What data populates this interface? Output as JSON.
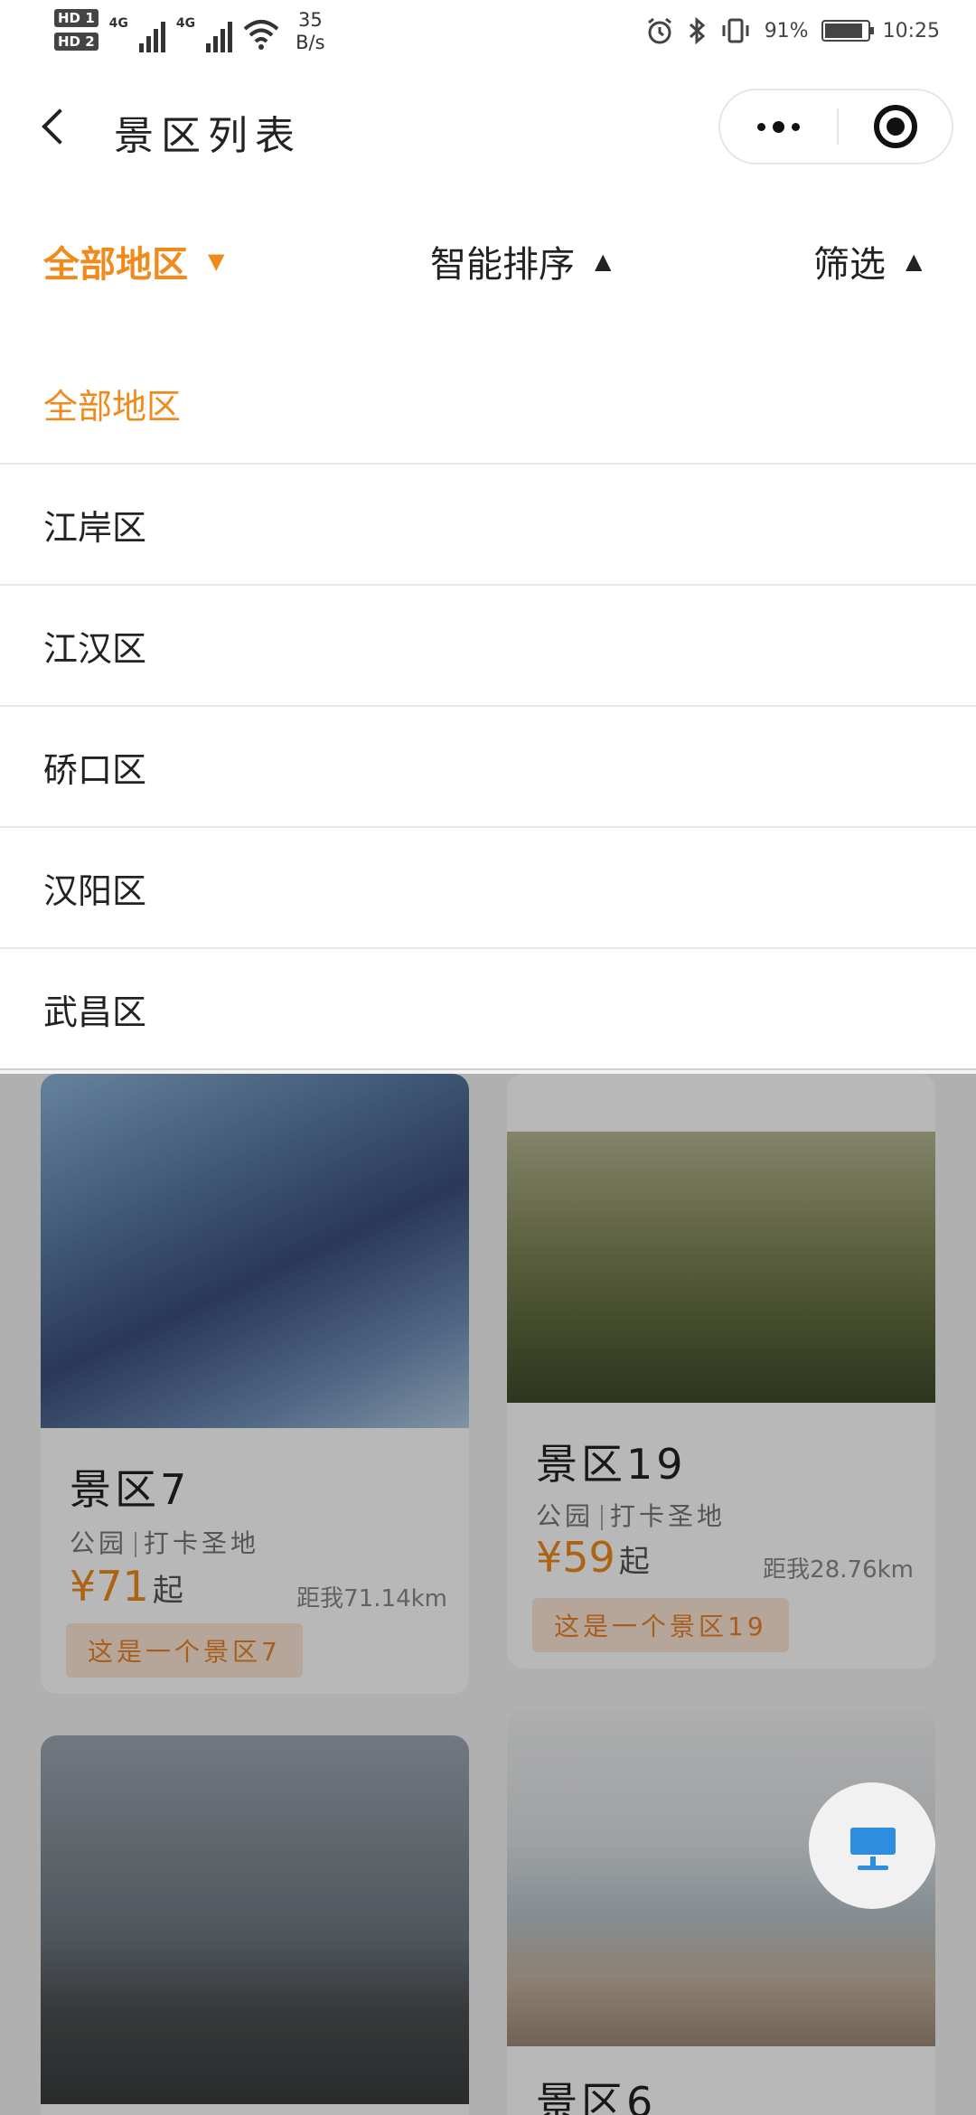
{
  "status_bar": {
    "network_speed_value": "35",
    "network_speed_unit": "B/s",
    "sim1_label": "HD 1",
    "sim2_label": "HD 2",
    "signal1_type": "4G",
    "signal2_type": "4G",
    "battery_percent": "91%",
    "battery_level": 0.91,
    "time": "10:25"
  },
  "titlebar": {
    "title": "景区列表"
  },
  "filters": {
    "region": "全部地区",
    "sort": "智能排序",
    "filter": "筛选",
    "accent_color": "#f08a1c"
  },
  "dropdown": {
    "items": [
      "全部地区",
      "江岸区",
      "江汉区",
      "硚口区",
      "汉阳区",
      "武昌区"
    ],
    "selected_index": 0
  },
  "cards": [
    {
      "name": "景区7",
      "tag1": "公园",
      "tag2": "打卡圣地",
      "price": "¥71",
      "price_suffix": "起",
      "distance": "距我71.14km",
      "desc": "这是一个景区7"
    },
    {
      "name": "景区19",
      "tag1": "公园",
      "tag2": "打卡圣地",
      "price": "¥59",
      "price_suffix": "起",
      "distance": "距我28.76km",
      "desc": "这是一个景区19"
    },
    {
      "name": "景区6"
    }
  ],
  "float_button": {
    "icon": "monitor-icon"
  }
}
